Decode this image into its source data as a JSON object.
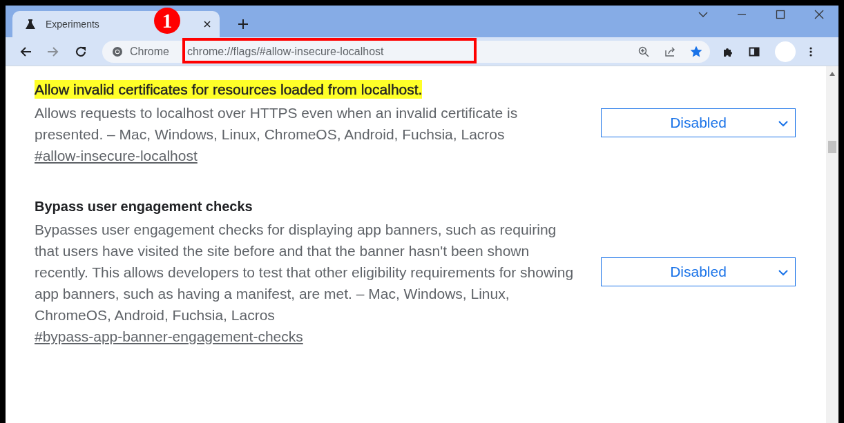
{
  "tab": {
    "title": "Experiments",
    "selected": true
  },
  "callout": "1",
  "address_bar": {
    "site_label": "Chrome",
    "url": "chrome://flags/#allow-insecure-localhost",
    "bookmarked": true
  },
  "flags": [
    {
      "title": "Allow invalid certificates for resources loaded from localhost.",
      "highlighted": true,
      "description": "Allows requests to localhost over HTTPS even when an invalid certificate is presented. – Mac, Windows, Linux, ChromeOS, Android, Fuchsia, Lacros",
      "link": "#allow-insecure-localhost",
      "value": "Disabled"
    },
    {
      "title": "Bypass user engagement checks",
      "highlighted": false,
      "description": "Bypasses user engagement checks for displaying app banners, such as requiring that users have visited the site before and that the banner hasn't been shown recently. This allows developers to test that other eligibility requirements for showing app banners, such as having a manifest, are met. – Mac, Windows, Linux, ChromeOS, Android, Fuchsia, Lacros",
      "link": "#bypass-app-banner-engagement-checks",
      "value": "Disabled"
    }
  ]
}
